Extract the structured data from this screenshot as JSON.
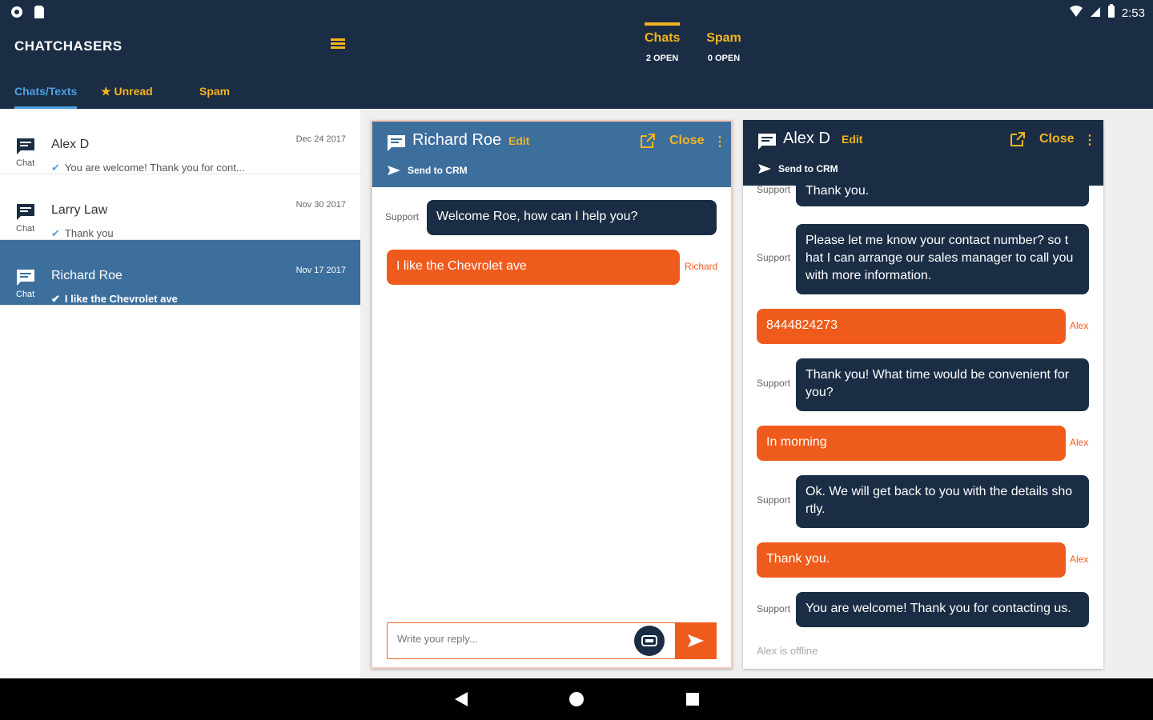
{
  "status": {
    "time": "2:53"
  },
  "app": {
    "brand": "CHATCHASERS"
  },
  "top_tabs": [
    {
      "label": "Chats",
      "sub": "2 OPEN"
    },
    {
      "label": "Spam",
      "sub": "0 OPEN"
    }
  ],
  "sub_tabs": [
    {
      "label": "Chats/Texts"
    },
    {
      "label": "Unread"
    },
    {
      "label": "Spam"
    }
  ],
  "conversations": [
    {
      "name": "Alex D",
      "type": "Chat",
      "date": "Dec 24 2017",
      "preview": "You are welcome! Thank you for cont..."
    },
    {
      "name": "Larry Law",
      "type": "Chat",
      "date": "Nov 30 2017",
      "preview": "Thank you"
    },
    {
      "name": "Richard Roe",
      "type": "Chat",
      "date": "Nov 17 2017",
      "preview": "I like the Chevrolet ave"
    }
  ],
  "chat1": {
    "name": "Richard Roe",
    "edit": "Edit",
    "close": "Close",
    "crm": "Send to CRM",
    "messages": [
      {
        "from": "Support",
        "text": "Welcome Roe, how can I help you?"
      },
      {
        "from": "Richard",
        "text": "I like the Chevrolet ave"
      }
    ],
    "reply_placeholder": "Write your reply..."
  },
  "chat2": {
    "name": "Alex D",
    "edit": "Edit",
    "close": "Close",
    "crm": "Send to CRM",
    "messages": [
      {
        "from": "Support",
        "text": "Thank you."
      },
      {
        "from": "Support",
        "text": "Please let me know your contact number? so t hat I can arrange our sales manager to call you with more information."
      },
      {
        "from": "Alex",
        "text": "8444824273"
      },
      {
        "from": "Support",
        "text": "Thank you! What time would be convenient for you?"
      },
      {
        "from": "Alex",
        "text": "In morning"
      },
      {
        "from": "Support",
        "text": "Ok. We will get back to you with the details sho rtly."
      },
      {
        "from": "Alex",
        "text": "Thank you."
      },
      {
        "from": "Support",
        "text": "You are welcome! Thank you for contacting us."
      }
    ],
    "offline": "Alex is offline"
  },
  "colors": {
    "navy": "#1a2d45",
    "accent": "#f5b41e",
    "orange": "#ef5b1c",
    "blue": "#3d6f9d",
    "link": "#4ea0e0"
  }
}
